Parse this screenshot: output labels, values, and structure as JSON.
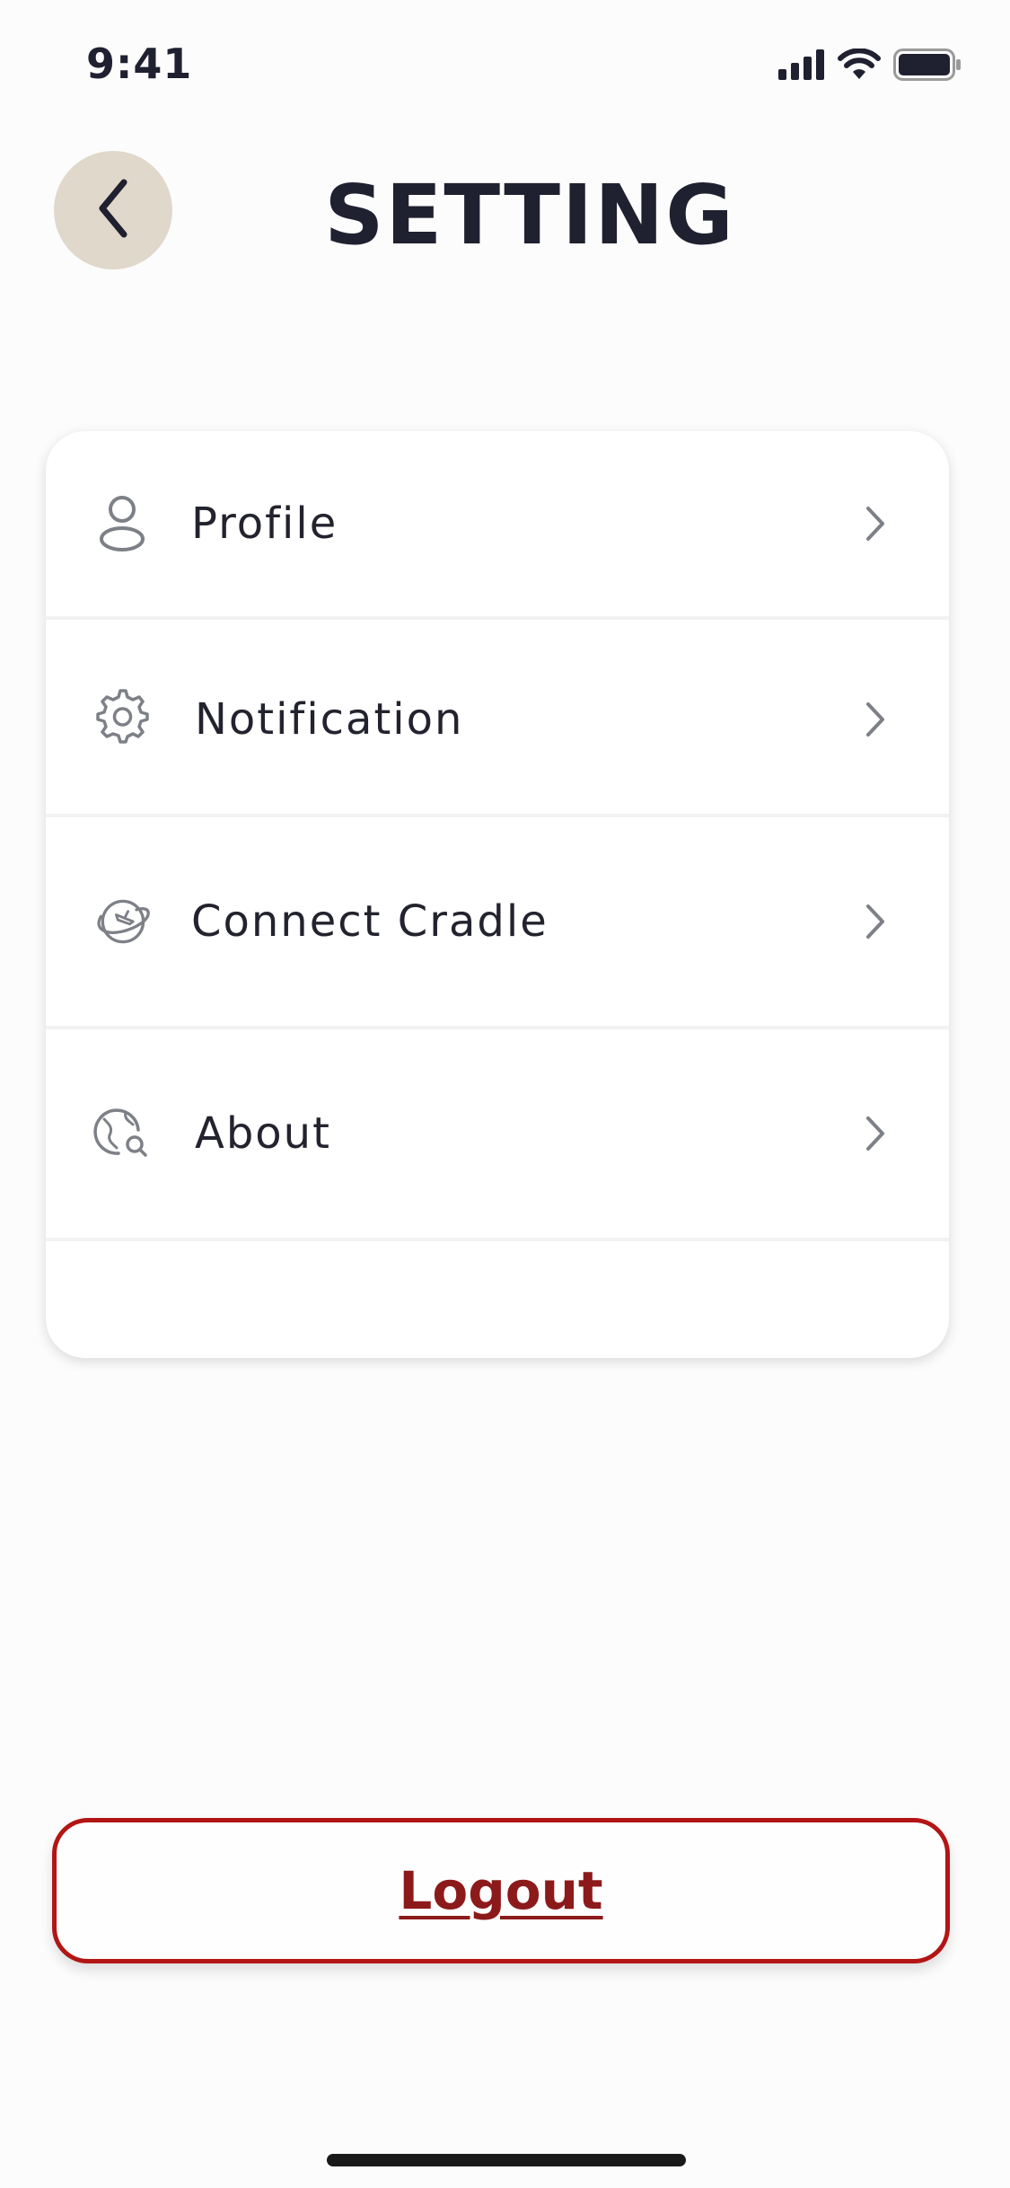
{
  "status_bar": {
    "time": "9:41",
    "icons": [
      "cellular-signal-icon",
      "wifi-icon",
      "battery-icon"
    ]
  },
  "header": {
    "title": "SETTING",
    "back_icon": "chevron-left-icon"
  },
  "settings": {
    "items": [
      {
        "label": "Profile",
        "icon": "user-icon"
      },
      {
        "label": "Notification",
        "icon": "gear-icon"
      },
      {
        "label": "Connect Cradle",
        "icon": "globe-plane-icon"
      },
      {
        "label": "About",
        "icon": "globe-search-icon"
      }
    ]
  },
  "logout": {
    "label": "Logout"
  },
  "colors": {
    "background": "#fcfcfc",
    "back_button_bg": "#e0d8cb",
    "title_text": "#1f2030",
    "logout_border": "#b31515",
    "logout_text": "#8c1a1a",
    "icon_gray": "#7d8087"
  }
}
